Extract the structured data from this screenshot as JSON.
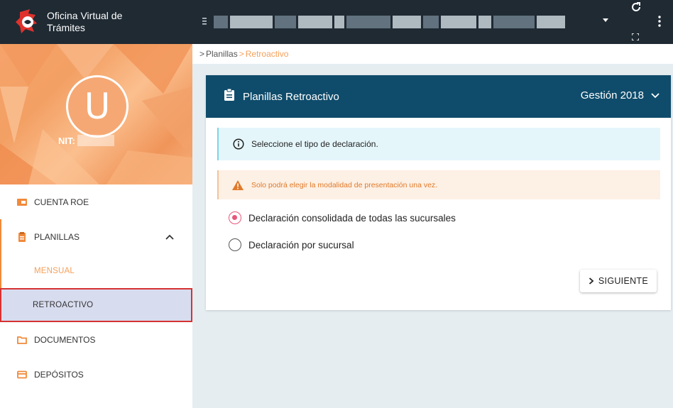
{
  "app": {
    "title": "Oficina Virtual de Trámites"
  },
  "profile": {
    "avatar_letter": "U",
    "nit_label": "NIT:"
  },
  "sidebar": {
    "items": [
      {
        "label": "CUENTA ROE",
        "icon": "card-icon"
      },
      {
        "label": "PLANILLAS",
        "icon": "clipboard-icon"
      },
      {
        "label": "DOCUMENTOS",
        "icon": "folder-icon"
      },
      {
        "label": "DEPÓSITOS",
        "icon": "credit-card-icon"
      }
    ],
    "subitems": [
      {
        "label": "MENSUAL"
      },
      {
        "label": "RETROACTIVO"
      }
    ]
  },
  "breadcrumb": {
    "sep": ">",
    "parent": "Planillas",
    "current": "Retroactivo"
  },
  "card": {
    "title": "Planillas Retroactivo",
    "gestion": "Gestión 2018"
  },
  "alerts": {
    "info": "Seleccione el tipo de declaración.",
    "warning": "Solo podrá elegir la modalidad de presentación una vez."
  },
  "options": [
    {
      "label": "Declaración consolidada de todas las sucursales",
      "checked": true
    },
    {
      "label": "Declaración por sucursal",
      "checked": false
    }
  ],
  "actions": {
    "next_label": "SIGUIENTE"
  },
  "colors": {
    "topbar": "#1f2a33",
    "card_header": "#0f4c6b",
    "accent_orange": "#f08a3c",
    "radio_pink": "#e8567a"
  }
}
